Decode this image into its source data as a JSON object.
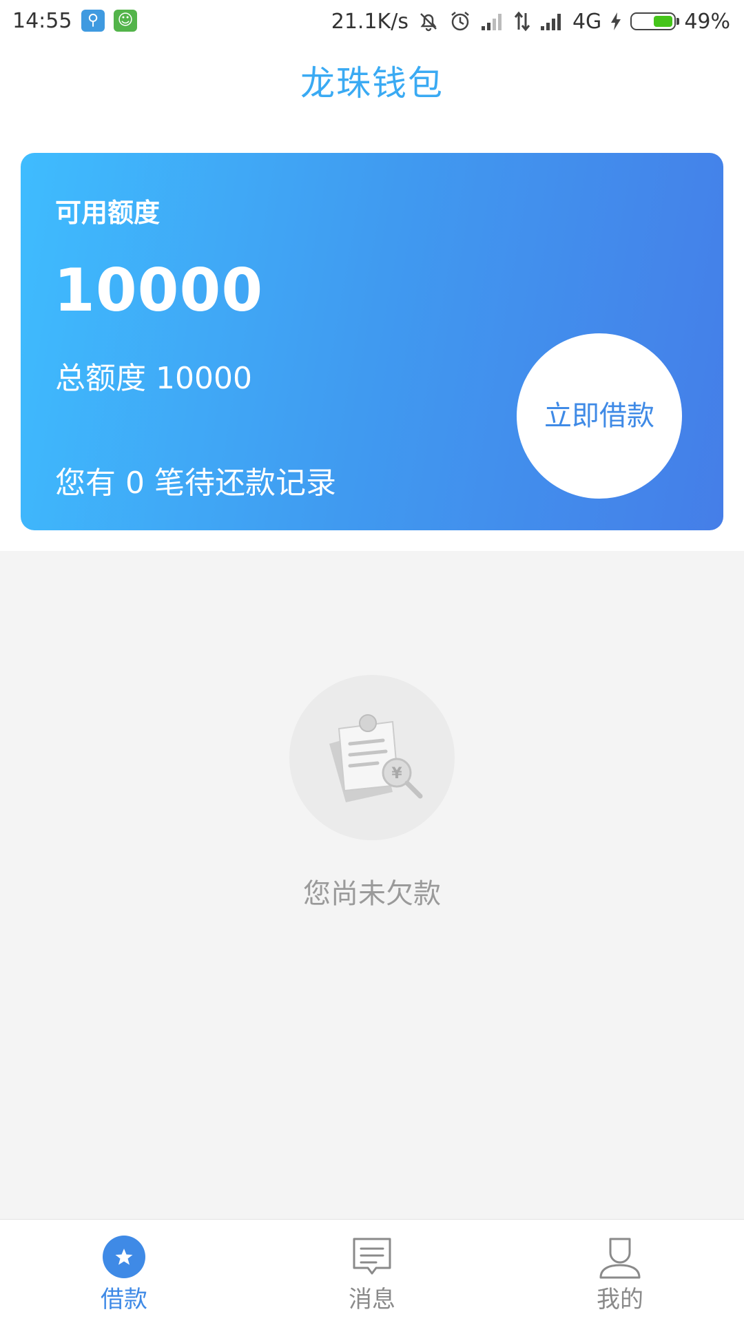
{
  "status_bar": {
    "time": "14:55",
    "net_speed": "21.1K/s",
    "network_type": "4G",
    "battery": "49%",
    "battery_level": 0.49,
    "icons": [
      "usb-icon",
      "robot-icon",
      "mute-icon",
      "alarm-icon",
      "signal-icon",
      "data-transfer-icon",
      "signal-icon",
      "charging-icon",
      "battery-icon"
    ],
    "battery_color": "#45c41a"
  },
  "header": {
    "title": "龙珠钱包",
    "color": "#3aaaf3"
  },
  "credit_card": {
    "available_label": "可用额度",
    "available_amount": "10000",
    "total_label": "总额度 10000",
    "pending_label": "您有 0 笔待还款记录",
    "borrow_button": "立即借款",
    "gradient_colors": [
      "#3fbcfe",
      "#457ee8"
    ]
  },
  "empty_state": {
    "icon": "receipt-search-icon",
    "message": "您尚未欠款"
  },
  "bottom_nav": {
    "items": [
      {
        "label": "借款",
        "icon": "star-icon",
        "active": true
      },
      {
        "label": "消息",
        "icon": "message-icon",
        "active": false
      },
      {
        "label": "我的",
        "icon": "user-icon",
        "active": false
      }
    ],
    "active_color": "#3f8ae6",
    "inactive_color": "#8a8a8a"
  }
}
